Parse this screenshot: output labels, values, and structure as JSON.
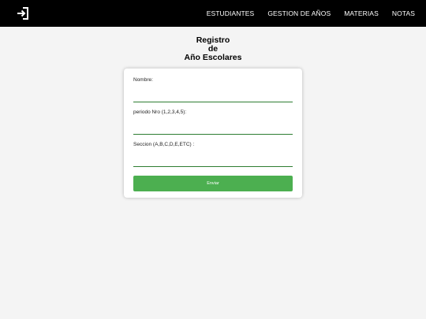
{
  "navbar": {
    "logo_icon": "logout-icon",
    "links": [
      "ESTUDIANTES",
      "GESTION DE AÑOS",
      "MATERIAS",
      "NOTAS"
    ]
  },
  "title": {
    "line1": "Registro",
    "line2": "de",
    "line3": "Año Escolares"
  },
  "form": {
    "nombre_label": "Nombre:",
    "periodo_label": "periodo Nro (1,2,3,4,5):",
    "seccion_label": "Seccion (A,B,C,D,E,ETC) :",
    "submit_label": "Enviar"
  },
  "colors": {
    "navbar_bg": "#000000",
    "accent": "#4caf50",
    "input_underline": "#2e7d32",
    "page_bg": "#f4f4f4"
  }
}
